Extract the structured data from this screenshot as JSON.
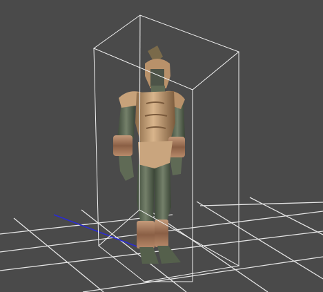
{
  "viewport": {
    "background_color": "#4a4a4a",
    "grid_color": "#e6e6e6",
    "axis_x_color": "#2b2bd6",
    "bounding_box_color": "#f2f2f2",
    "armor_color": "#c7a27a",
    "skin_color": "#5f6a55",
    "selected_object": "gladiator-model"
  }
}
